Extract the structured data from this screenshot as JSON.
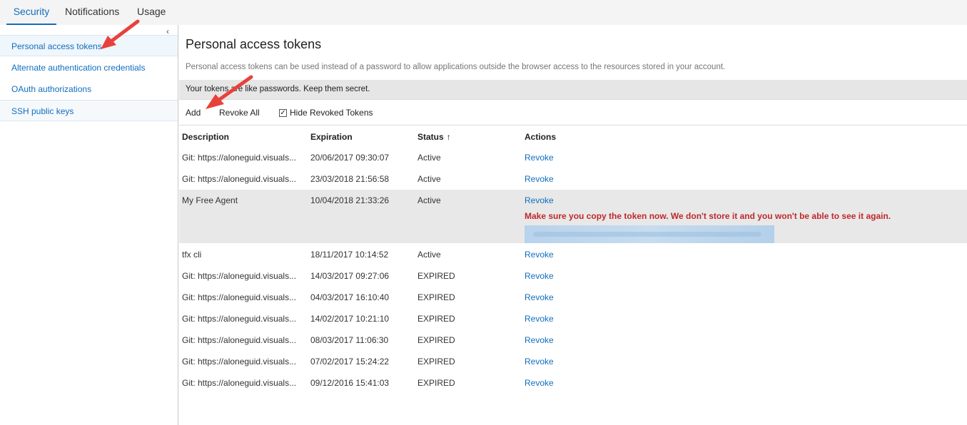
{
  "tabs": [
    {
      "label": "Security",
      "active": true
    },
    {
      "label": "Notifications",
      "active": false
    },
    {
      "label": "Usage",
      "active": false
    }
  ],
  "sidebar": {
    "items": [
      {
        "label": "Personal access tokens"
      },
      {
        "label": "Alternate authentication credentials"
      },
      {
        "label": "OAuth authorizations"
      },
      {
        "label": "SSH public keys"
      }
    ]
  },
  "main": {
    "title": "Personal access tokens",
    "description": "Personal access tokens can be used instead of a password to allow applications outside the browser access to the resources stored in your account.",
    "notice": "Your tokens are like passwords. Keep them secret.",
    "toolbar": {
      "add": "Add",
      "revoke_all": "Revoke All",
      "hide_revoked": "Hide Revoked Tokens",
      "hide_revoked_checked": true
    },
    "columns": {
      "description": "Description",
      "expiration": "Expiration",
      "status": "Status",
      "actions": "Actions"
    },
    "rows": [
      {
        "description": "Git: https://aloneguid.visuals...",
        "expiration": "20/06/2017 09:30:07",
        "status": "Active",
        "action": "Revoke"
      },
      {
        "description": "Git: https://aloneguid.visuals...",
        "expiration": "23/03/2018 21:56:58",
        "status": "Active",
        "action": "Revoke"
      },
      {
        "description": "My Free Agent",
        "expiration": "10/04/2018 21:33:26",
        "status": "Active",
        "action": "Revoke",
        "warning": "Make sure you copy the token now. We don't store it and you won't be able to see it again."
      },
      {
        "description": "tfx cli",
        "expiration": "18/11/2017 10:14:52",
        "status": "Active",
        "action": "Revoke"
      },
      {
        "description": "Git: https://aloneguid.visuals...",
        "expiration": "14/03/2017 09:27:06",
        "status": "EXPIRED",
        "action": "Revoke"
      },
      {
        "description": "Git: https://aloneguid.visuals...",
        "expiration": "04/03/2017 16:10:40",
        "status": "EXPIRED",
        "action": "Revoke"
      },
      {
        "description": "Git: https://aloneguid.visuals...",
        "expiration": "14/02/2017 10:21:10",
        "status": "EXPIRED",
        "action": "Revoke"
      },
      {
        "description": "Git: https://aloneguid.visuals...",
        "expiration": "08/03/2017 11:06:30",
        "status": "EXPIRED",
        "action": "Revoke"
      },
      {
        "description": "Git: https://aloneguid.visuals...",
        "expiration": "07/02/2017 15:24:22",
        "status": "EXPIRED",
        "action": "Revoke"
      },
      {
        "description": "Git: https://aloneguid.visuals...",
        "expiration": "09/12/2016 15:41:03",
        "status": "EXPIRED",
        "action": "Revoke"
      }
    ]
  },
  "colors": {
    "accent": "#106ebe",
    "warning": "#c0282b",
    "annotation_arrow": "#e8413c"
  },
  "icons": {
    "collapse": "chevron-left-icon",
    "sort": "arrow-up-icon",
    "annotation": "red-arrow-icon"
  }
}
